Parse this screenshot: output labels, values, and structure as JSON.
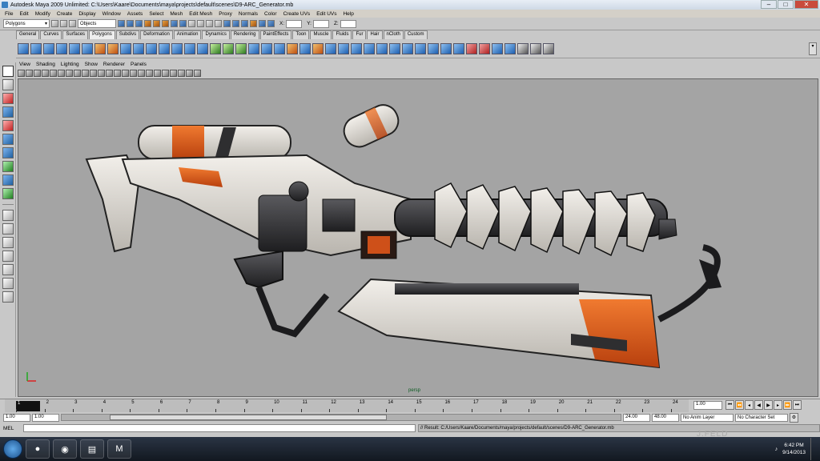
{
  "window": {
    "title": "Autodesk Maya 2009 Unlimited: C:\\Users\\Kaare\\Documents\\maya\\projects\\default\\scenes\\D9-ARC_Generator.mb",
    "controls": [
      "–",
      "□",
      "✕"
    ]
  },
  "menubar": [
    "File",
    "Edit",
    "Modify",
    "Create",
    "Display",
    "Window",
    "Assets",
    "Select",
    "Mesh",
    "Edit Mesh",
    "Proxy",
    "Normals",
    "Color",
    "Create UVs",
    "Edit UVs",
    "Help"
  ],
  "statusline": {
    "menuset": "Polygons",
    "selection_mode": "Objects",
    "x_label": "X:",
    "y_label": "Y:",
    "z_label": "Z:"
  },
  "shelf_tabs": [
    "General",
    "Curves",
    "Surfaces",
    "Polygons",
    "Subdivs",
    "Deformation",
    "Animation",
    "Dynamics",
    "Rendering",
    "PaintEffects",
    "Toon",
    "Muscle",
    "Fluids",
    "Fur",
    "Hair",
    "nCloth",
    "Custom"
  ],
  "active_shelf_tab": "Polygons",
  "panel_menu": [
    "View",
    "Shading",
    "Lighting",
    "Show",
    "Renderer",
    "Panels"
  ],
  "viewport": {
    "camera": "persp",
    "axis_x": "x",
    "axis_y": "y"
  },
  "timeline": {
    "ticks": [
      "1",
      "2",
      "3",
      "4",
      "5",
      "6",
      "7",
      "8",
      "9",
      "10",
      "11",
      "12",
      "13",
      "14",
      "15",
      "16",
      "17",
      "18",
      "19",
      "20",
      "21",
      "22",
      "23",
      "24"
    ],
    "current_frame": "1.00"
  },
  "range": {
    "start_time": "1.00",
    "playback_start": "1.00",
    "playback_end": "24.00",
    "end_time": "48.00",
    "anim_layer": "No Anim Layer",
    "character_set": "No Character Set"
  },
  "command": {
    "mel_label": "MEL",
    "result": "// Result: C:/Users/Kaare/Documents/maya/projects/default/scenes/D9-ARC_Generator.mb"
  },
  "taskbar": {
    "time": "6:42 PM",
    "date": "9/14/2013"
  },
  "watermark": "J.FELD",
  "colors": {
    "viewport_bg": "#a4a4a4",
    "accent_orange": "#e0561a",
    "gun_white": "#e6e2dc",
    "gun_dark": "#2e2e30"
  }
}
